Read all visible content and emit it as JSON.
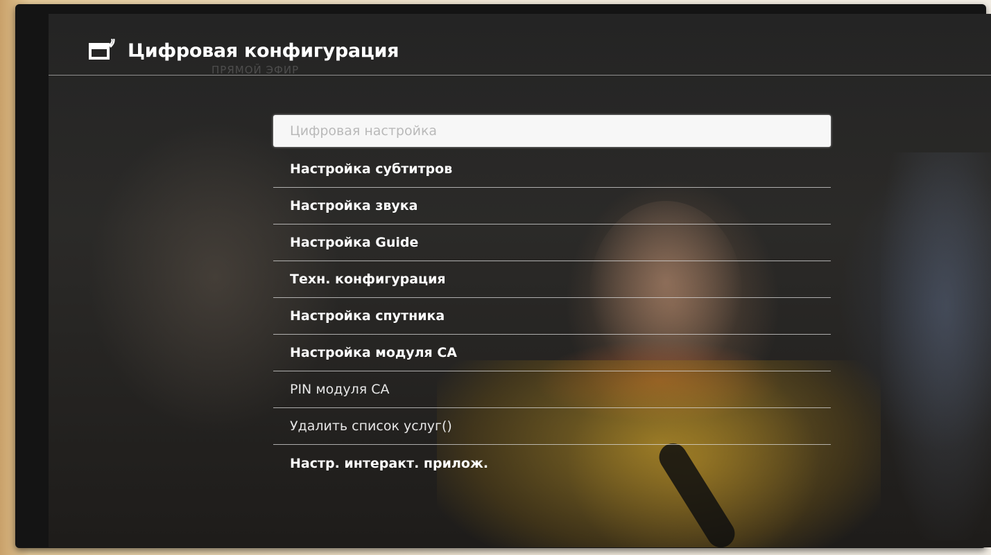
{
  "header": {
    "title": "Цифровая конфигурация",
    "icon": "tv-settings-icon",
    "ghost_text": "ПРЯМОЙ ЭФИР"
  },
  "menu": {
    "items": [
      {
        "label": "Цифровая настройка",
        "state": "selected"
      },
      {
        "label": "Настройка субтитров",
        "state": "normal"
      },
      {
        "label": "Настройка звука",
        "state": "normal"
      },
      {
        "label": "Настройка Guide",
        "state": "normal"
      },
      {
        "label": "Техн. конфигурация",
        "state": "normal"
      },
      {
        "label": "Настройка спутника",
        "state": "normal"
      },
      {
        "label": "Настройка модуля CA",
        "state": "normal"
      },
      {
        "label": "PIN модуля CA",
        "state": "dimmed"
      },
      {
        "label": "Удалить список услуг()",
        "state": "dimmed"
      },
      {
        "label": "Настр. интеракт. прилож.",
        "state": "normal"
      }
    ]
  },
  "colors": {
    "selected_bg": "#f7f7f7",
    "selected_text": "#b9b9b9",
    "item_text": "#ffffff",
    "divider": "#dcdcdc"
  }
}
